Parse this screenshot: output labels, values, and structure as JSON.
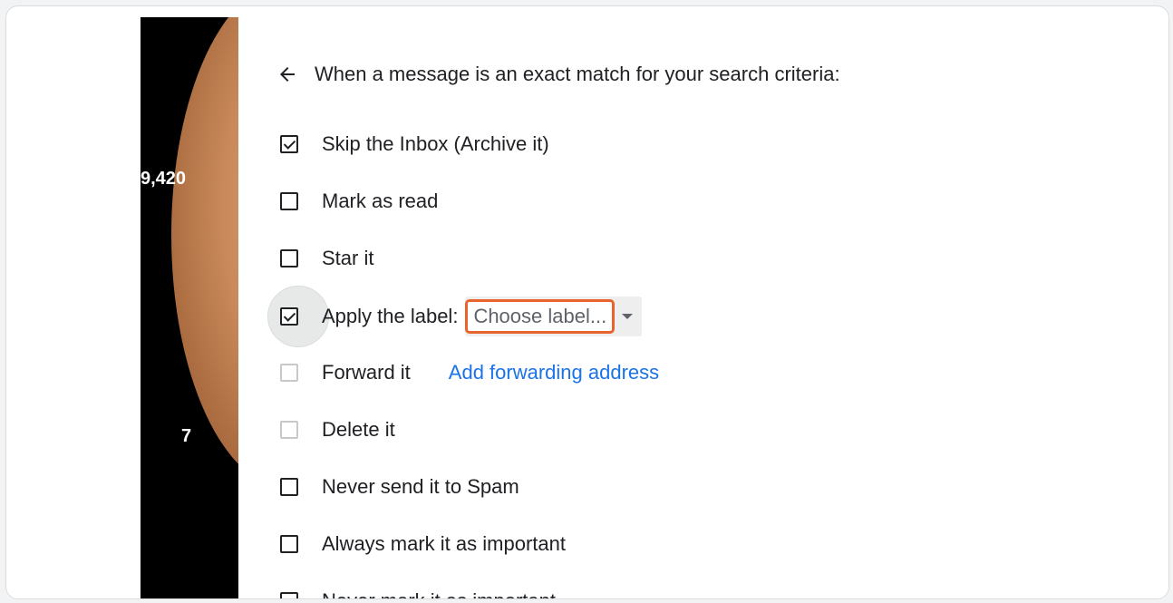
{
  "sidebar": {
    "count_top": "9,420",
    "count_bottom": "7"
  },
  "header": {
    "title": "When a message is an exact match for your search criteria:"
  },
  "options": [
    {
      "label": "Skip the Inbox (Archive it)",
      "checked": true
    },
    {
      "label": "Mark as read",
      "checked": false
    },
    {
      "label": "Star it",
      "checked": false
    },
    {
      "label": "Apply the label:",
      "checked": true,
      "select_value": "Choose label..."
    },
    {
      "label": "Forward it",
      "checked": false,
      "disabled": true,
      "link": "Add forwarding address"
    },
    {
      "label": "Delete it",
      "checked": false,
      "disabled": true
    },
    {
      "label": "Never send it to Spam",
      "checked": false
    },
    {
      "label": "Always mark it as important",
      "checked": false
    },
    {
      "label": "Never mark it as important",
      "checked": false
    }
  ],
  "colors": {
    "highlight": "#e8642c",
    "link": "#1a73e8"
  },
  "icons": {
    "back": "arrow-left-icon",
    "dropdown": "caret-down-icon"
  }
}
